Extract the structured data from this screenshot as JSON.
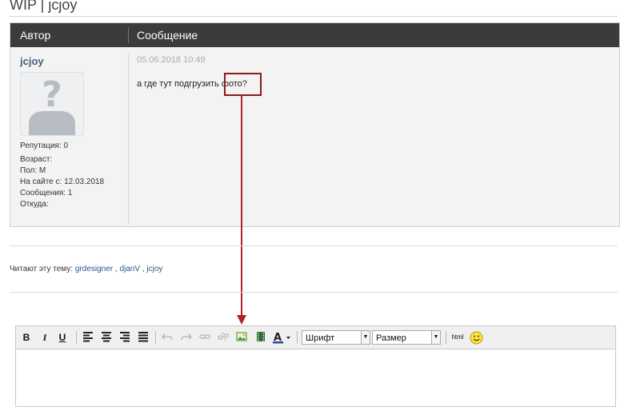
{
  "page": {
    "title": "WIP | jcjoy"
  },
  "table": {
    "header_author": "Автор",
    "header_message": "Сообщение"
  },
  "post": {
    "author": "jcjoy",
    "reputation": "Репутация: 0",
    "age": "Возраст:",
    "gender": "Пол: М",
    "member_since": "На сайте с: 12.03.2018",
    "messages": "Сообщения: 1",
    "location": "Откуда:",
    "date": "05.06.2018 10:49",
    "text_before": "а где тут подгрузить ",
    "text_highlight": "фото?"
  },
  "readers": {
    "label": "Читают эту тему:",
    "users": [
      "grdesigner",
      "djanV",
      "jcjoy"
    ]
  },
  "editor": {
    "bold": "B",
    "italic": "I",
    "underline": "U",
    "font_select": "Шрифт",
    "size_select": "Размер",
    "html": "html"
  },
  "colors": {
    "header_bg": "#3b3b3b",
    "link": "#2a5a8c",
    "author": "#3f5f7f",
    "annotation": "#b22222"
  }
}
